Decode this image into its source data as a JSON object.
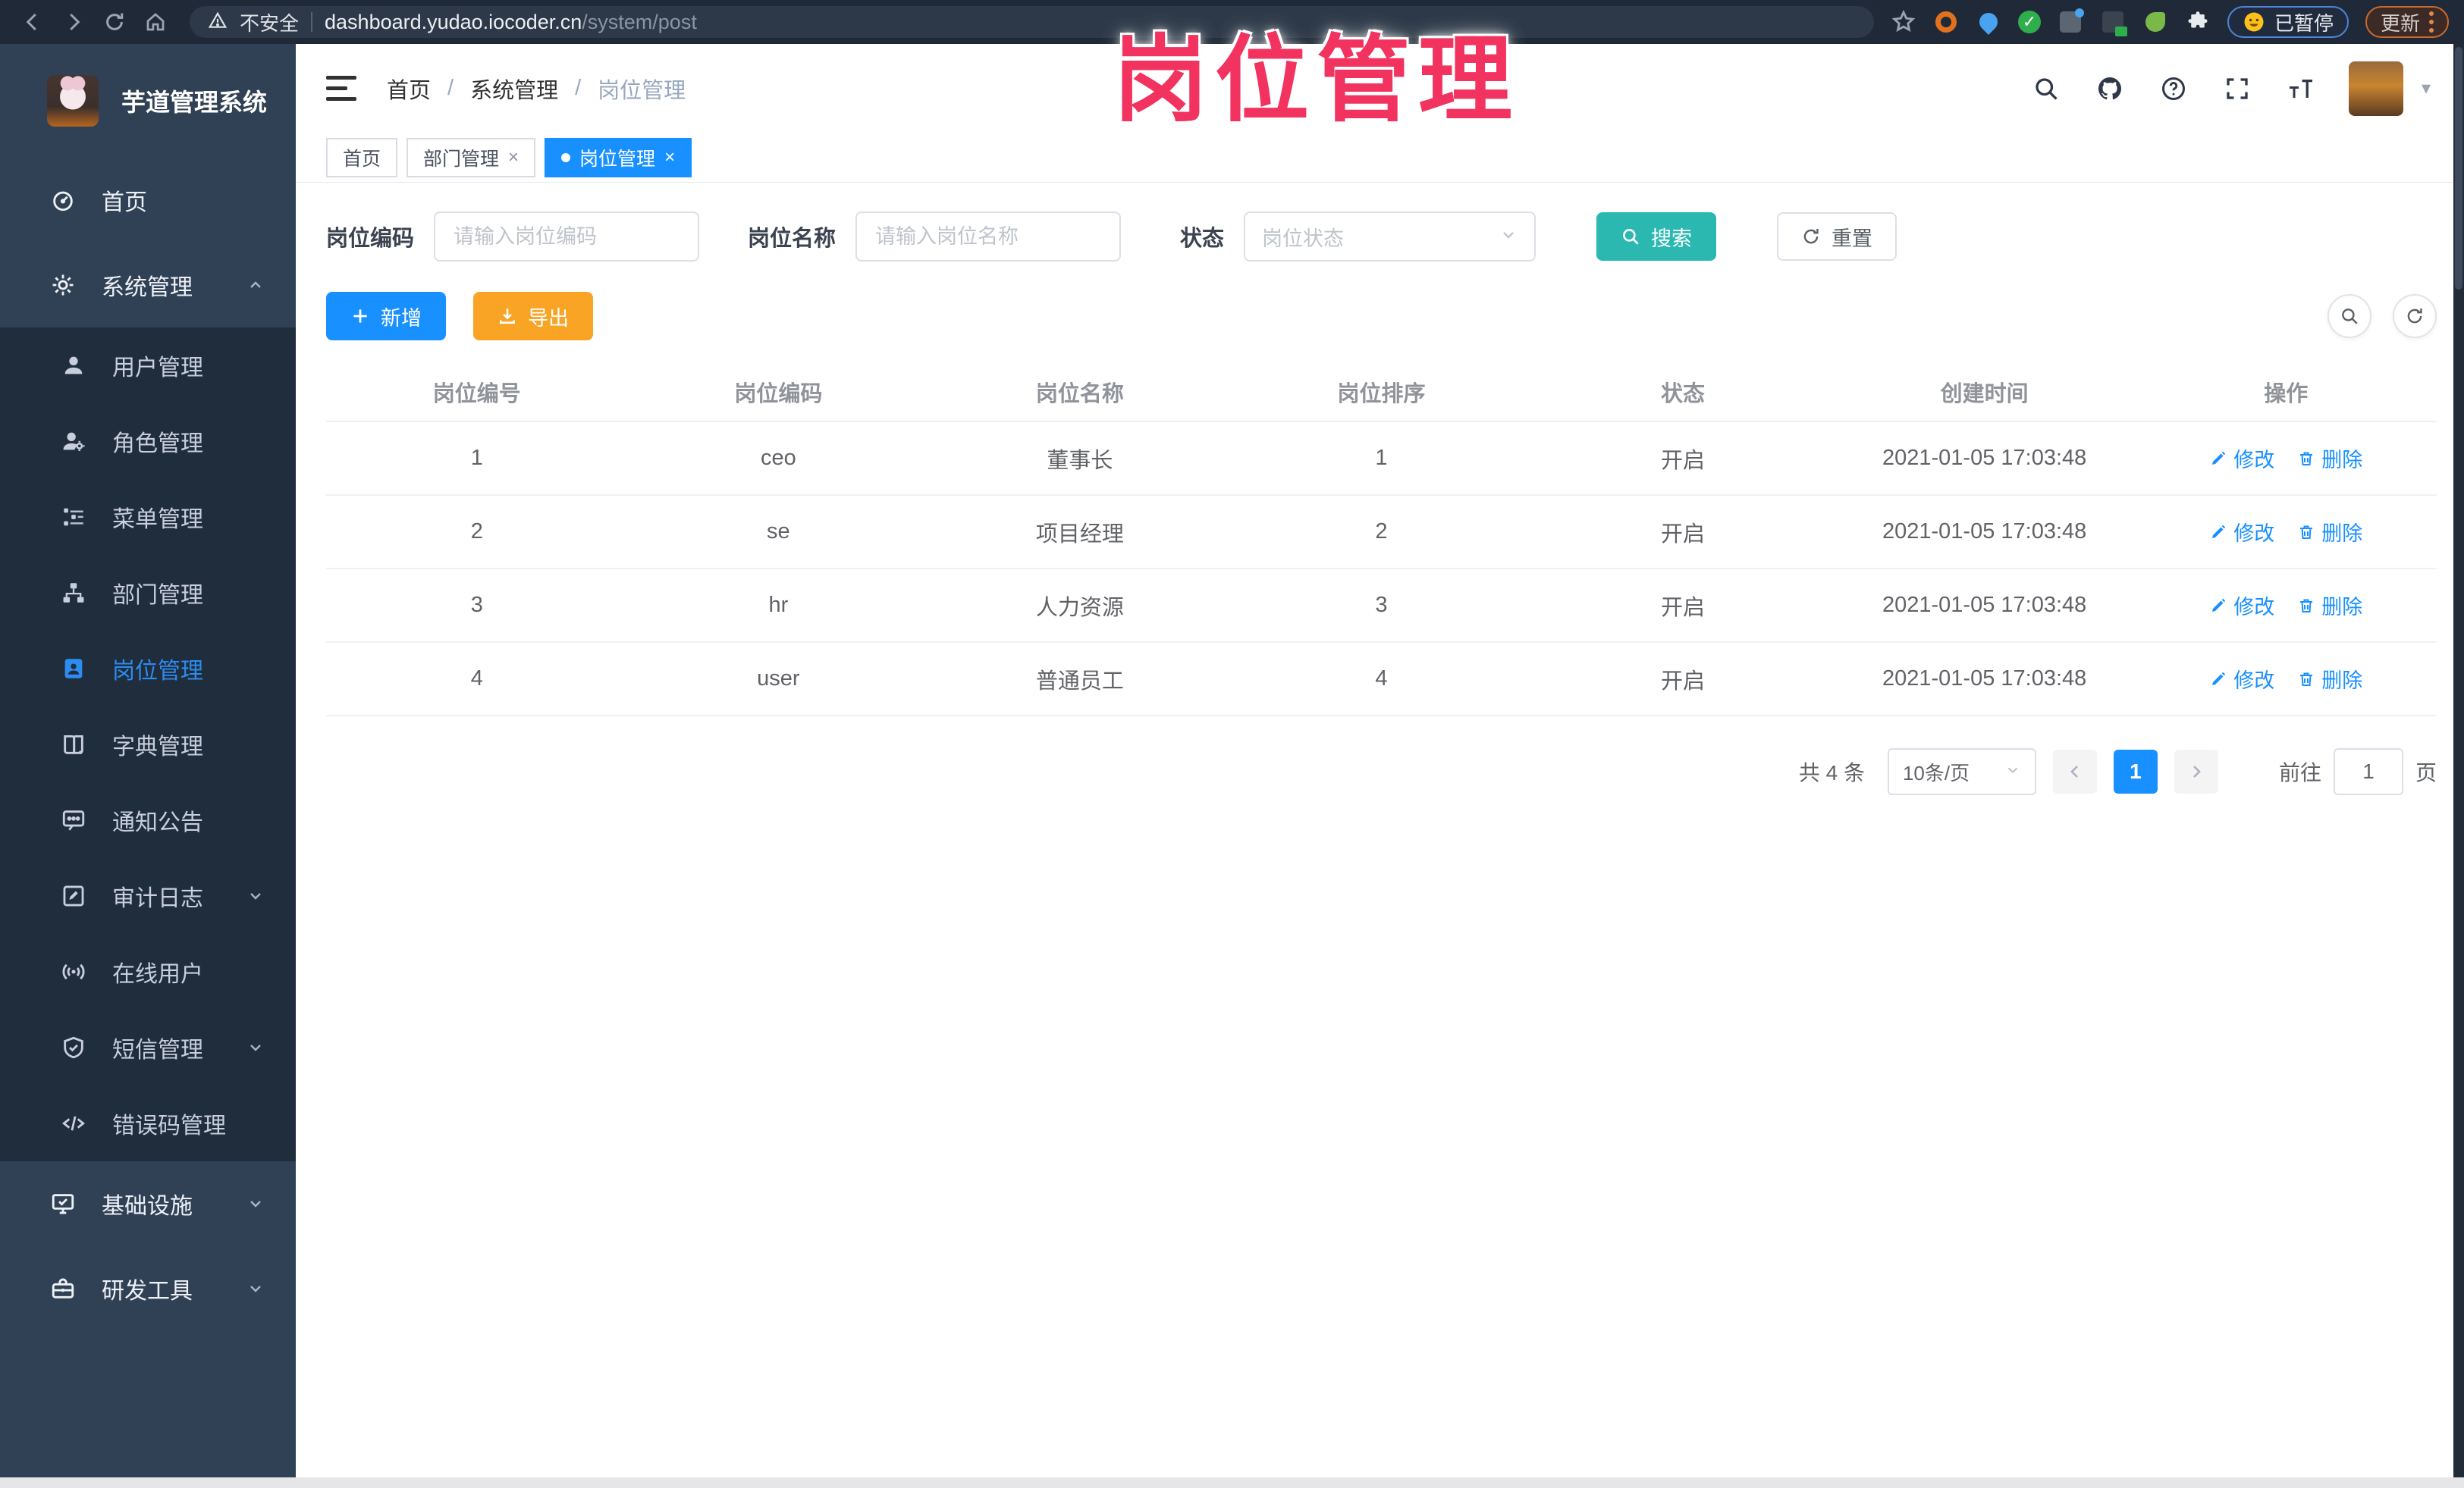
{
  "browser": {
    "security_label": "不安全",
    "url_host": "dashboard.yudao.iocoder.cn",
    "url_path": "/system/post",
    "paused_badge": "已暂停",
    "update_button": "更新"
  },
  "watermark": "岗位管理",
  "sidebar": {
    "app_title": "芋道管理系统",
    "items": [
      {
        "label": "首页"
      },
      {
        "label": "系统管理"
      },
      {
        "label": "用户管理"
      },
      {
        "label": "角色管理"
      },
      {
        "label": "菜单管理"
      },
      {
        "label": "部门管理"
      },
      {
        "label": "岗位管理"
      },
      {
        "label": "字典管理"
      },
      {
        "label": "通知公告"
      },
      {
        "label": "审计日志"
      },
      {
        "label": "在线用户"
      },
      {
        "label": "短信管理"
      },
      {
        "label": "错误码管理"
      },
      {
        "label": "基础设施"
      },
      {
        "label": "研发工具"
      }
    ]
  },
  "breadcrumb": {
    "home": "首页",
    "section": "系统管理",
    "current": "岗位管理"
  },
  "tabs": [
    {
      "label": "首页"
    },
    {
      "label": "部门管理"
    },
    {
      "label": "岗位管理"
    }
  ],
  "filters": {
    "code_label": "岗位编码",
    "code_placeholder": "请输入岗位编码",
    "name_label": "岗位名称",
    "name_placeholder": "请输入岗位名称",
    "status_label": "状态",
    "status_placeholder": "岗位状态",
    "search_label": "搜索",
    "reset_label": "重置"
  },
  "toolbar": {
    "add_label": "新增",
    "export_label": "导出"
  },
  "table": {
    "columns": [
      "岗位编号",
      "岗位编码",
      "岗位名称",
      "岗位排序",
      "状态",
      "创建时间",
      "操作"
    ],
    "edit_label": "修改",
    "delete_label": "删除",
    "rows": [
      {
        "id": "1",
        "code": "ceo",
        "name": "董事长",
        "sort": "1",
        "status": "开启",
        "created": "2021-01-05 17:03:48"
      },
      {
        "id": "2",
        "code": "se",
        "name": "项目经理",
        "sort": "2",
        "status": "开启",
        "created": "2021-01-05 17:03:48"
      },
      {
        "id": "3",
        "code": "hr",
        "name": "人力资源",
        "sort": "3",
        "status": "开启",
        "created": "2021-01-05 17:03:48"
      },
      {
        "id": "4",
        "code": "user",
        "name": "普通员工",
        "sort": "4",
        "status": "开启",
        "created": "2021-01-05 17:03:48"
      }
    ]
  },
  "pagination": {
    "total_text": "共 4 条",
    "page_size": "10条/页",
    "current_page": "1",
    "goto_label": "前往",
    "goto_value": "1",
    "page_suffix": "页"
  },
  "colors": {
    "primary": "#1890ff",
    "search_teal": "#2bb8b0",
    "export_orange": "#f9a425",
    "watermark_pink": "#f2325f",
    "sidebar_bg": "#304156",
    "submenu_bg": "#1f2d3d"
  }
}
